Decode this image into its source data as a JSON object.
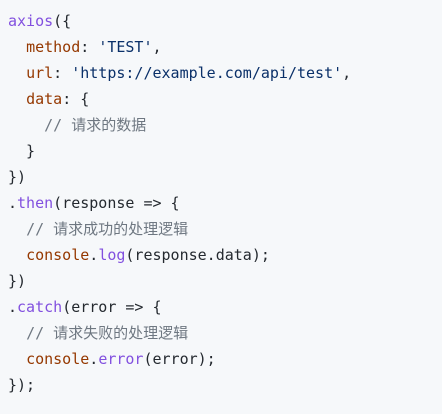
{
  "code": {
    "language": "javascript",
    "lines": [
      {
        "tokens": [
          {
            "t": "axios",
            "c": "tk-fn"
          },
          {
            "t": "({",
            "c": "tk-plain"
          }
        ]
      },
      {
        "tokens": [
          {
            "t": "  ",
            "c": "tk-plain"
          },
          {
            "t": "method",
            "c": "tk-key"
          },
          {
            "t": ": ",
            "c": "tk-plain"
          },
          {
            "t": "'TEST'",
            "c": "tk-str"
          },
          {
            "t": ",",
            "c": "tk-plain"
          }
        ]
      },
      {
        "tokens": [
          {
            "t": "  ",
            "c": "tk-plain"
          },
          {
            "t": "url",
            "c": "tk-key"
          },
          {
            "t": ": ",
            "c": "tk-plain"
          },
          {
            "t": "'https://example.com/api/test'",
            "c": "tk-str"
          },
          {
            "t": ",",
            "c": "tk-plain"
          }
        ]
      },
      {
        "tokens": [
          {
            "t": "  ",
            "c": "tk-plain"
          },
          {
            "t": "data",
            "c": "tk-key"
          },
          {
            "t": ": {",
            "c": "tk-plain"
          }
        ]
      },
      {
        "tokens": [
          {
            "t": "    ",
            "c": "tk-plain"
          },
          {
            "t": "// 请求的数据",
            "c": "tk-comment"
          }
        ]
      },
      {
        "tokens": [
          {
            "t": "  }",
            "c": "tk-plain"
          }
        ]
      },
      {
        "tokens": [
          {
            "t": "})",
            "c": "tk-plain"
          }
        ]
      },
      {
        "tokens": [
          {
            "t": ".",
            "c": "tk-plain"
          },
          {
            "t": "then",
            "c": "tk-method"
          },
          {
            "t": "(response => {",
            "c": "tk-plain"
          }
        ]
      },
      {
        "tokens": [
          {
            "t": "  ",
            "c": "tk-plain"
          },
          {
            "t": "// 请求成功的处理逻辑",
            "c": "tk-comment"
          }
        ]
      },
      {
        "tokens": [
          {
            "t": "  ",
            "c": "tk-plain"
          },
          {
            "t": "console",
            "c": "tk-obj"
          },
          {
            "t": ".",
            "c": "tk-plain"
          },
          {
            "t": "log",
            "c": "tk-method"
          },
          {
            "t": "(response.data);",
            "c": "tk-plain"
          }
        ]
      },
      {
        "tokens": [
          {
            "t": "})",
            "c": "tk-plain"
          }
        ]
      },
      {
        "tokens": [
          {
            "t": ".",
            "c": "tk-plain"
          },
          {
            "t": "catch",
            "c": "tk-method"
          },
          {
            "t": "(error => {",
            "c": "tk-plain"
          }
        ]
      },
      {
        "tokens": [
          {
            "t": "  ",
            "c": "tk-plain"
          },
          {
            "t": "// 请求失败的处理逻辑",
            "c": "tk-comment"
          }
        ]
      },
      {
        "tokens": [
          {
            "t": "  ",
            "c": "tk-plain"
          },
          {
            "t": "console",
            "c": "tk-obj"
          },
          {
            "t": ".",
            "c": "tk-plain"
          },
          {
            "t": "error",
            "c": "tk-method"
          },
          {
            "t": "(error);",
            "c": "tk-plain"
          }
        ]
      },
      {
        "tokens": [
          {
            "t": "});",
            "c": "tk-plain"
          }
        ]
      }
    ]
  },
  "colors": {
    "background": "#f6f8fa",
    "function": "#8250df",
    "property": "#953800",
    "string": "#0a3069",
    "comment": "#6e7781",
    "plain": "#24292f"
  }
}
